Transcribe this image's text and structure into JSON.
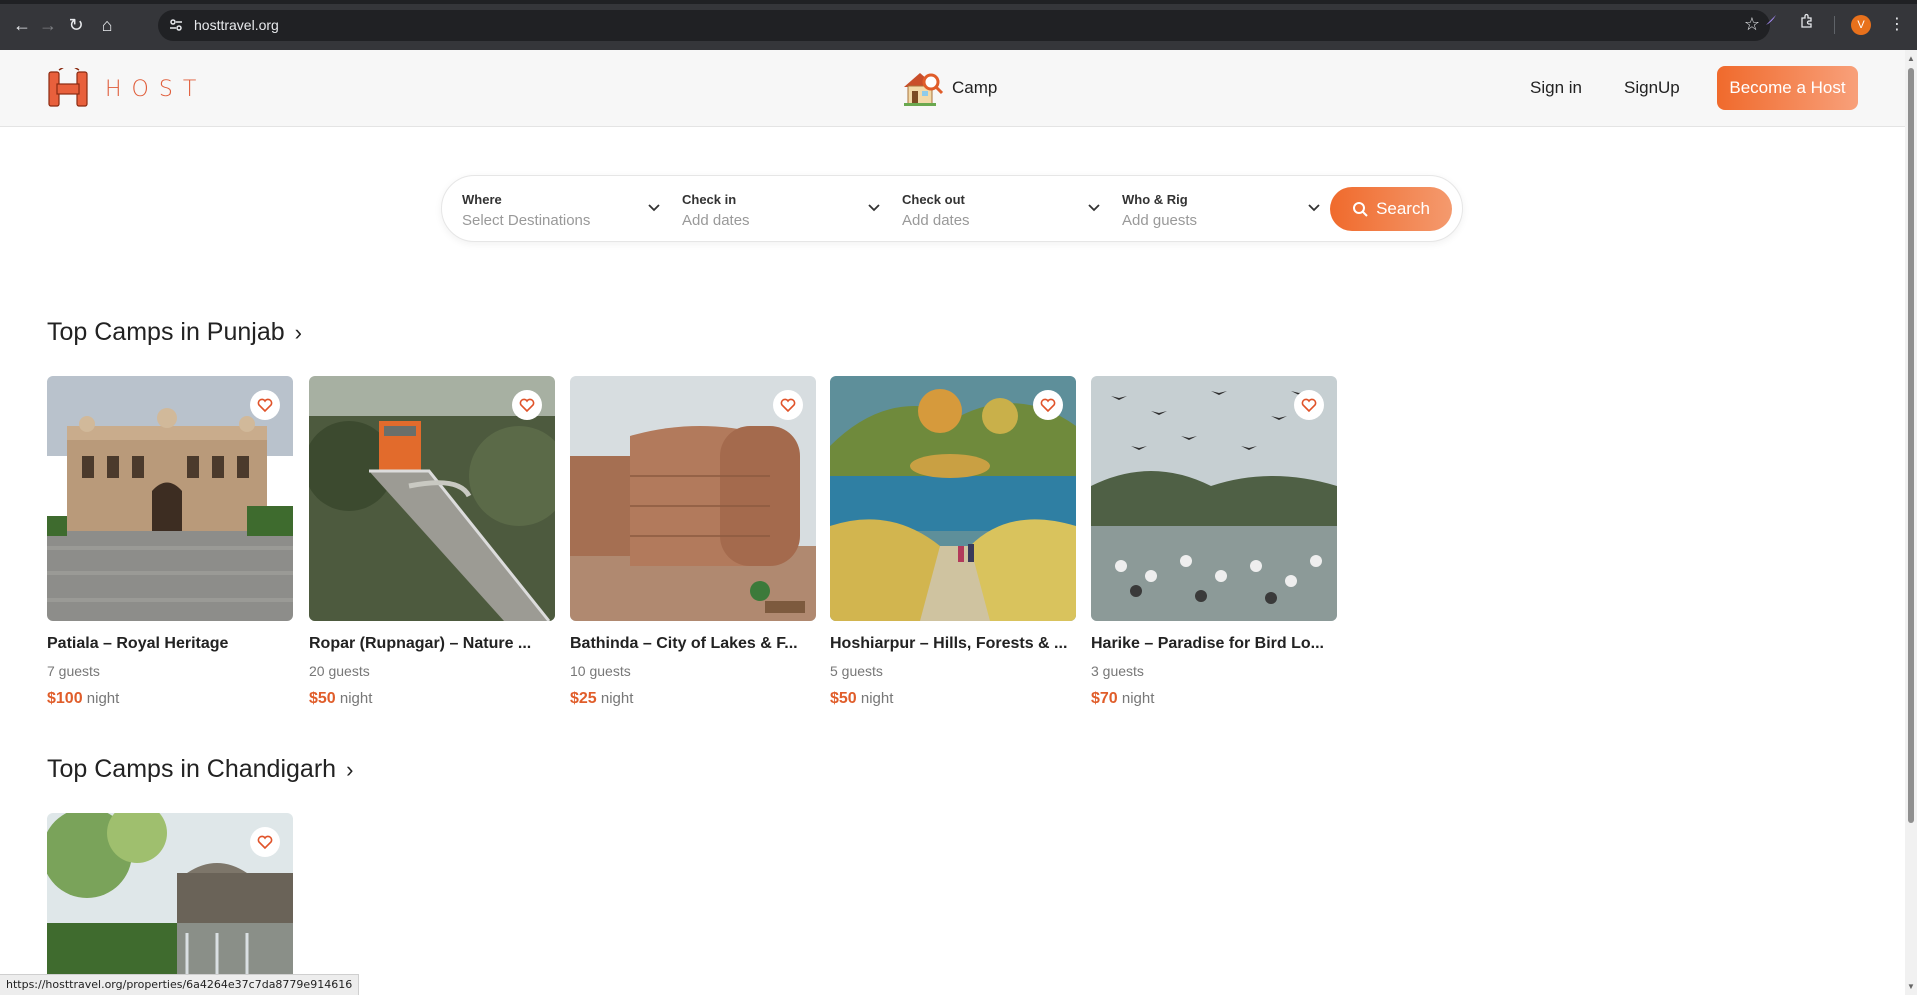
{
  "browser": {
    "url": "hosttravel.org",
    "profile_initial": "V",
    "status_url": "https://hosttravel.org/properties/6a4264e37c7da8779e914616"
  },
  "header": {
    "logo_text": "HOST",
    "nav_tab": "Camp",
    "sign_in": "Sign in",
    "sign_up": "SignUp",
    "become_host": "Become a Host"
  },
  "search": {
    "where_label": "Where",
    "where_value": "Select Destinations",
    "checkin_label": "Check in",
    "checkin_value": "Add dates",
    "checkout_label": "Check out",
    "checkout_value": "Add dates",
    "who_label": "Who & Rig",
    "who_value": "Add guests",
    "button": "Search"
  },
  "sections": [
    {
      "title": "Top Camps in Punjab",
      "cards": [
        {
          "title": "Patiala – Royal Heritage",
          "guests": "7 guests",
          "price": "$100",
          "unit": "night",
          "image": "palace"
        },
        {
          "title": "Ropar (Rupnagar) – Nature ...",
          "guests": "20 guests",
          "price": "$50",
          "unit": "night",
          "image": "tower-walkway"
        },
        {
          "title": "Bathinda – City of Lakes & F...",
          "guests": "10 guests",
          "price": "$25",
          "unit": "night",
          "image": "fort"
        },
        {
          "title": "Hoshiarpur – Hills, Forests & ...",
          "guests": "5 guests",
          "price": "$50",
          "unit": "night",
          "image": "lake-path"
        },
        {
          "title": "Harike – Paradise for Bird Lo...",
          "guests": "3 guests",
          "price": "$70",
          "unit": "night",
          "image": "birds-wetland"
        }
      ]
    },
    {
      "title": "Top Camps in Chandigarh",
      "cards": [
        {
          "title": "",
          "guests": "",
          "price": "",
          "unit": "",
          "image": "waterfall-garden"
        }
      ]
    }
  ],
  "colors": {
    "brand": "#e05d3a",
    "accent_gradient_start": "#f06a2c",
    "accent_gradient_end": "#f8a07a"
  }
}
